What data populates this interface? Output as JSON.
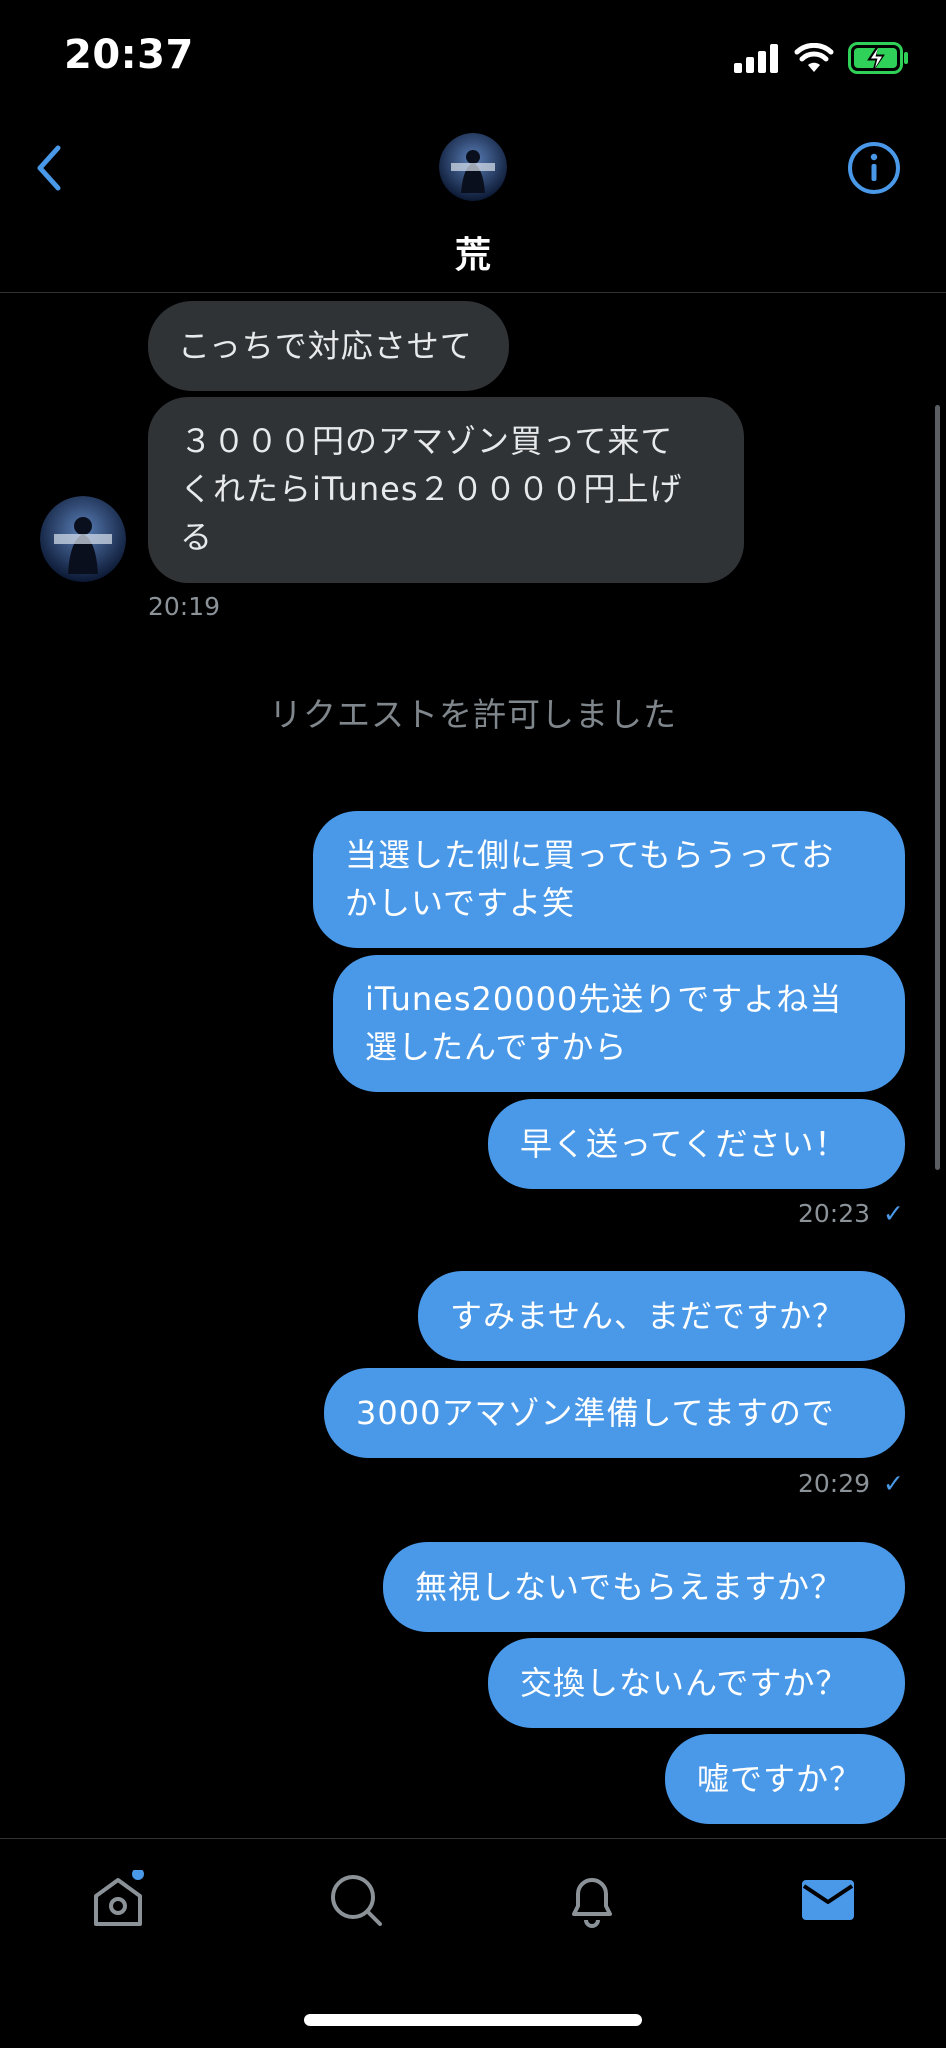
{
  "status_bar": {
    "time": "20:37"
  },
  "header": {
    "title": "荒"
  },
  "messages": {
    "received": [
      "こっちで対応させて",
      "３０００円のアマゾン買って来て\nくれたらiTunes２００００円上げ\nる"
    ],
    "received_time": "20:19",
    "system": "リクエストを許可しました",
    "sent_group1": [
      "当選した側に買ってもらうってお\nかしいですよ笑",
      "iTunes20000先送りですよね当\n選したんですから",
      "早く送ってください！"
    ],
    "sent_group1_time": "20:23",
    "sent_group2": [
      "すみません、まだですか？",
      "3000アマゾン準備してますので"
    ],
    "sent_group2_time": "20:29",
    "sent_group3": [
      "無視しないでもらえますか？",
      "交換しないんですか？",
      "嘘ですか？"
    ],
    "read_mark": "✓"
  },
  "colors": {
    "accent": "#4a99e9",
    "received_bubble": "#2f3336",
    "background": "#000000",
    "battery": "#30d158"
  },
  "icons": [
    "back-chevron-icon",
    "info-icon",
    "home-icon",
    "search-icon",
    "bell-icon",
    "mail-icon"
  ]
}
